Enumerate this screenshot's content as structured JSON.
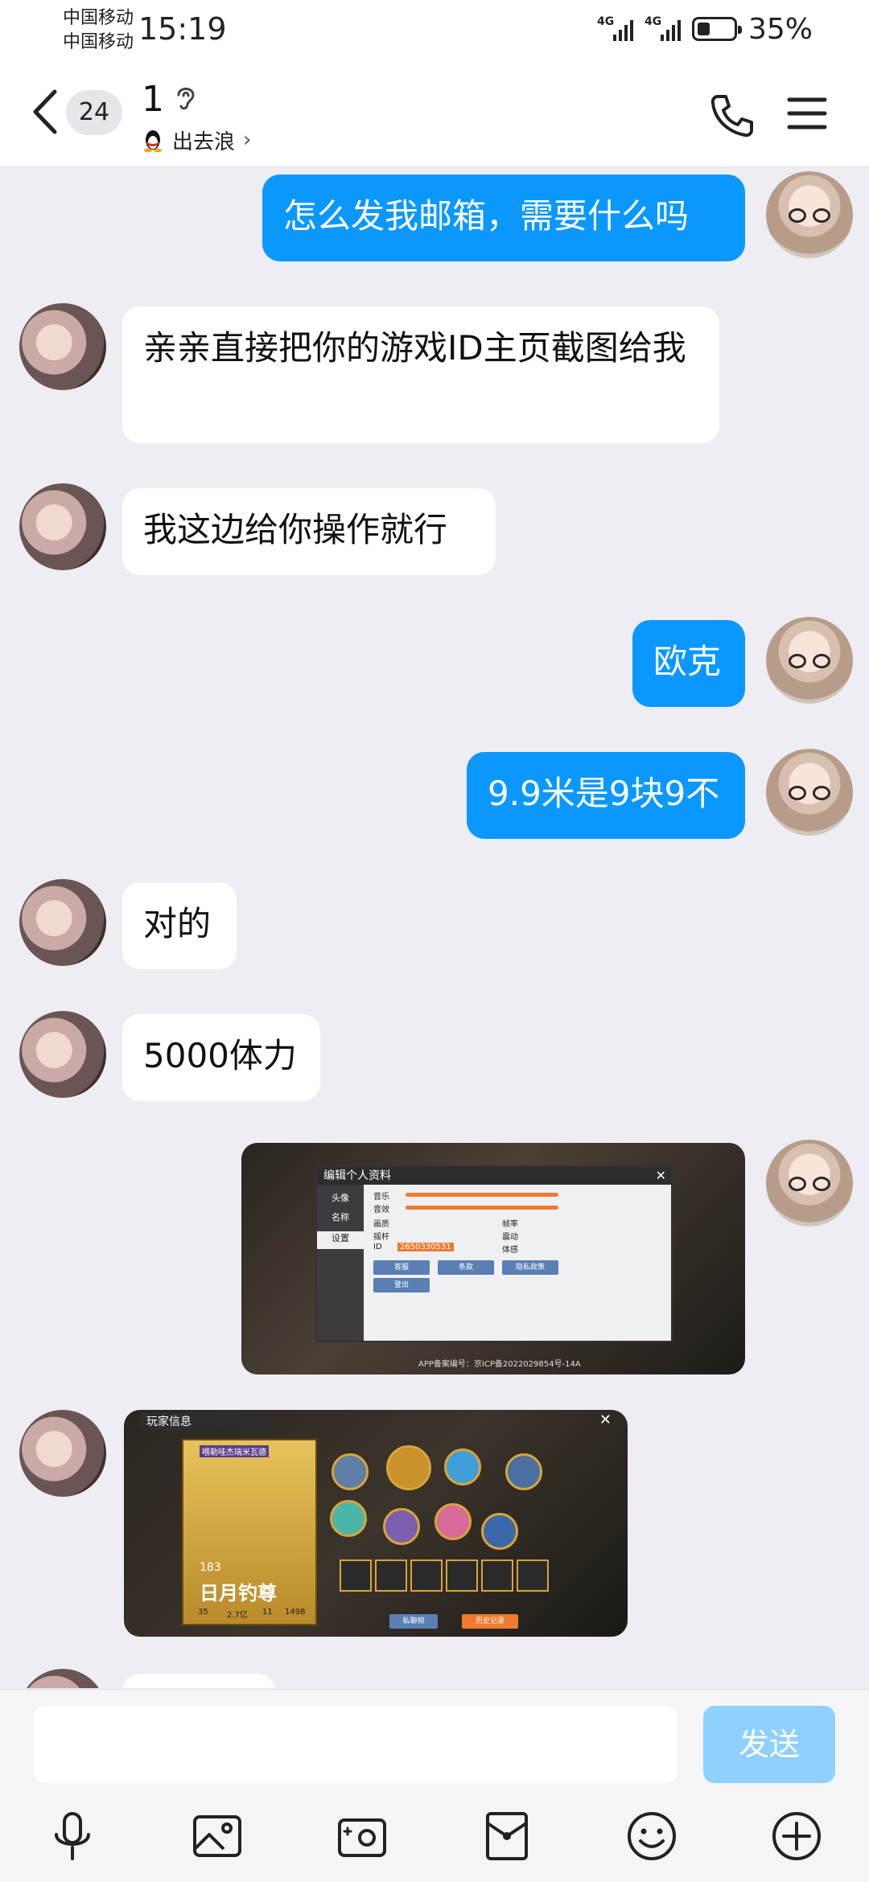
{
  "status_bar": {
    "carrier_1": "中国移动",
    "carrier_2": "中国移动",
    "time": "15:19",
    "network_1": "4G",
    "network_2": "4G",
    "battery_percent": "35%",
    "battery_level": 0.35
  },
  "header": {
    "unread_count": "24",
    "title": "1",
    "subtitle": "出去浪",
    "chevron": "›"
  },
  "messages": [
    {
      "side": "out",
      "text": "怎么发我邮箱，需要什么吗"
    },
    {
      "side": "in",
      "text": "亲亲直接把你的游戏ID主页截图给我"
    },
    {
      "side": "in",
      "text": "我这边给你操作就行"
    },
    {
      "side": "out",
      "text": "欧克"
    },
    {
      "side": "out",
      "text": "9.9米是9块9不"
    },
    {
      "side": "in",
      "text": "对的"
    },
    {
      "side": "in",
      "text": "5000体力"
    }
  ],
  "image_messages": {
    "settings_shot": {
      "panel_title": "编辑个人资料",
      "tabs": [
        "头像",
        "名称",
        "设置"
      ],
      "rows": [
        "音乐",
        "音效",
        "画质",
        "帧率",
        "摇杆",
        "震动",
        "ID",
        "体感"
      ],
      "id_value": "2650330531",
      "buttons": [
        "客服",
        "条款",
        "隐私政策",
        "登出"
      ],
      "footer": "APP备案编号：京ICP备2022029854号-14A"
    },
    "profile_shot": {
      "panel_title": "玩家信息",
      "player_name": "喂勒哇杰瑞米瓦德",
      "level": "183",
      "rank_title": "日月钓尊",
      "stats": [
        "35",
        "2.7亿",
        "11",
        "1498"
      ],
      "bottom_buttons": [
        "私聊频",
        "历史记录"
      ]
    }
  },
  "input_bar": {
    "placeholder": "",
    "send_label": "发送"
  },
  "toolbar_icons": [
    "microphone-icon",
    "image-icon",
    "camera-icon",
    "red-packet-icon",
    "emoji-icon",
    "plus-icon"
  ],
  "colors": {
    "outgoing_bubble": "#0a98ff",
    "incoming_bubble": "#ffffff",
    "background": "#ededf3",
    "send_button": "#8fd0ff"
  }
}
